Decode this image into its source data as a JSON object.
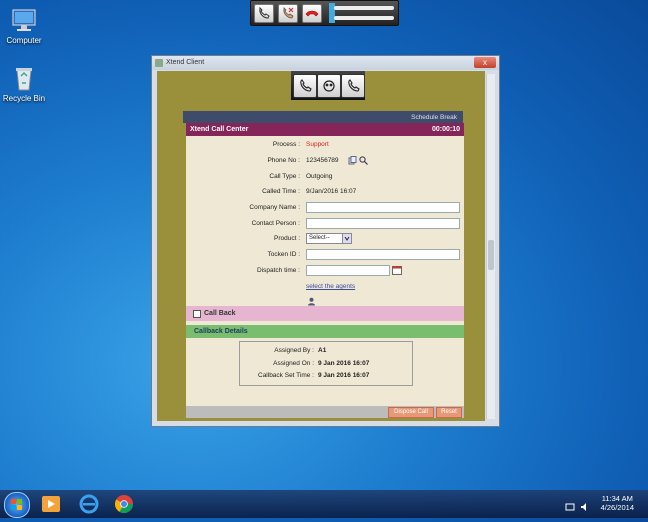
{
  "desktop": {
    "icons": [
      {
        "label": "Computer"
      },
      {
        "label": "Recycle Bin"
      }
    ]
  },
  "window": {
    "title": "Xtend Client",
    "close_label": "x",
    "schedule_break": "Schedule Break",
    "panel": {
      "title": "Xtend Call Center",
      "timer": "00:00:10",
      "fields": {
        "process": {
          "label": "Process :",
          "value": "Support"
        },
        "phone": {
          "label": "Phone No :",
          "value": "123456789"
        },
        "call_type": {
          "label": "Call Type :",
          "value": "Outgoing"
        },
        "called_time": {
          "label": "Called Time :",
          "value": "9/Jan/2016 16:07"
        },
        "company": {
          "label": "Company Name :",
          "value": ""
        },
        "contact": {
          "label": "Contact Person :",
          "value": ""
        },
        "product": {
          "label": "Product :",
          "value": "Select--"
        },
        "token": {
          "label": "Tocken ID :",
          "value": ""
        },
        "dispatch": {
          "label": "Dispatch time :",
          "value": ""
        }
      },
      "select_agents": "select the agents",
      "callback_label": "Call Back",
      "details_title": "Callback Details",
      "details": {
        "assigned_by": {
          "label": "Assigned By :",
          "value": "A1"
        },
        "assigned_on": {
          "label": "Assigned On :",
          "value": "9 Jan 2016 16:07"
        },
        "callback_set": {
          "label": "Callback Set Time :",
          "value": "9 Jan 2016 16:07"
        }
      },
      "dispose_button": "Dispose Call",
      "reset_button": "Reset"
    }
  },
  "taskbar": {
    "time": "11:34 AM",
    "date": "4/26/2014"
  }
}
